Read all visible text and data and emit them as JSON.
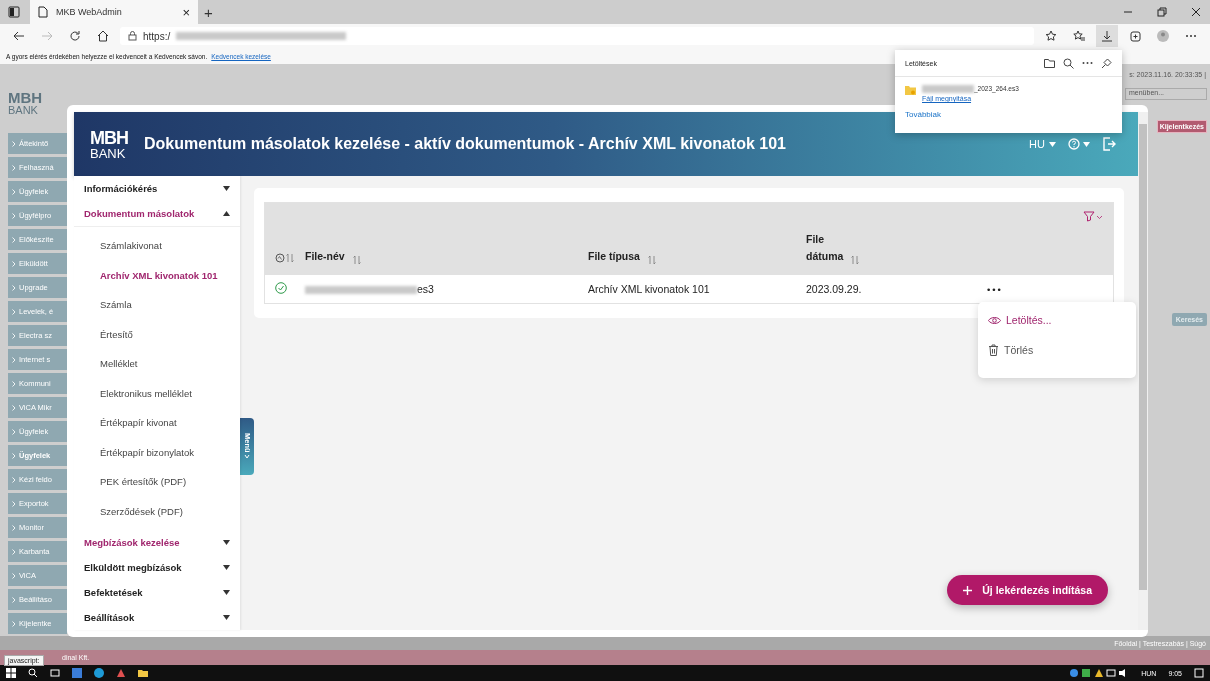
{
  "browser": {
    "tab": {
      "title": "MKB WebAdmin",
      "close": "×"
    },
    "new_tab": "+",
    "address": "https:/",
    "favorites_hint": "A gyors elérés érdekében helyezze el kedvenceit a Kedvencek sávon.",
    "favorites_link": "Kedvencek kezelése",
    "status_text": "javascript:"
  },
  "downloads": {
    "title": "Letöltések",
    "file": {
      "name": "_2023_264.es3",
      "action": "Fájl megnyitása"
    },
    "more": "Továbbiak"
  },
  "background": {
    "logo": {
      "mark": "MBH",
      "name": "BANK"
    },
    "session": "s: 2023.11.16. 20:33:35 |",
    "select": "menüben...",
    "logout": "Kijelentkezés",
    "search": "Keresés",
    "nav": [
      {
        "label": "Áttekintő",
        "selected": false
      },
      {
        "label": "Felhaszná",
        "selected": false
      },
      {
        "label": "Ügyfelek",
        "selected": false
      },
      {
        "label": "Ügyfélpro",
        "selected": false
      },
      {
        "label": "Előkészíte",
        "selected": false
      },
      {
        "label": "Elküldött",
        "selected": false
      },
      {
        "label": "Upgrade",
        "selected": false
      },
      {
        "label": "Levelek, é",
        "selected": false
      },
      {
        "label": "Electra sz",
        "selected": false
      },
      {
        "label": "Internet s",
        "selected": false
      },
      {
        "label": "Kommuni",
        "selected": false
      },
      {
        "label": "ViCA Mikr",
        "selected": false
      },
      {
        "label": "Ügyfelek",
        "selected": false
      },
      {
        "label": "Ügyfelek",
        "selected": true
      },
      {
        "label": "Kézi feldo",
        "selected": false
      },
      {
        "label": "Exportok",
        "selected": false
      },
      {
        "label": "Monitor",
        "selected": false
      },
      {
        "label": "Karbanta",
        "selected": false
      },
      {
        "label": "ViCA",
        "selected": false
      },
      {
        "label": "Beállításo",
        "selected": false
      },
      {
        "label": "Kijelentke",
        "selected": false
      }
    ],
    "footer": "Főoldal | Testreszabás | Súgó",
    "company": "dinal Kft."
  },
  "modal": {
    "logo": {
      "mark": "MBH",
      "name": "BANK"
    },
    "title": "Dokumentum másolatok kezelése - aktív dokumentumok - Archív XML kivonatok 101",
    "language": "HU"
  },
  "sidebar": {
    "toggle": "Menü",
    "groups": [
      {
        "label": "Információkérés",
        "active": false,
        "expanded": false
      },
      {
        "label": "Dokumentum másolatok",
        "active": true,
        "expanded": true,
        "children": [
          {
            "label": "Számlakivonat",
            "selected": false
          },
          {
            "label": "Archív XML kivonatok 101",
            "selected": true
          },
          {
            "label": "Számla",
            "selected": false
          },
          {
            "label": "Értesítő",
            "selected": false
          },
          {
            "label": "Melléklet",
            "selected": false
          },
          {
            "label": "Elektronikus melléklet",
            "selected": false
          },
          {
            "label": "Értékpapír kivonat",
            "selected": false
          },
          {
            "label": "Értékpapír bizonylatok",
            "selected": false
          },
          {
            "label": "PEK értesítők (PDF)",
            "selected": false
          },
          {
            "label": "Szerződések (PDF)",
            "selected": false
          }
        ]
      },
      {
        "label": "Megbízások kezelése",
        "active": true,
        "expanded": false
      },
      {
        "label": "Elküldött megbízások",
        "active": false,
        "expanded": false
      },
      {
        "label": "Befektetések",
        "active": false,
        "expanded": false
      },
      {
        "label": "Beállítások",
        "active": false,
        "expanded": false
      }
    ]
  },
  "table": {
    "columns": [
      "File-név",
      "File típusa",
      "File\ndátuma"
    ],
    "rows": [
      {
        "completed": true,
        "file_name": "es3",
        "file_type": "Archív XML kivonatok 101",
        "file_date": "2023.09.29.",
        "actions": "•••"
      }
    ]
  },
  "row_menu": {
    "items": [
      {
        "label": "Letöltés...",
        "kind": "view",
        "selected": true
      },
      {
        "label": "Törlés",
        "kind": "delete",
        "selected": false
      }
    ]
  },
  "new_query_button": {
    "label": "Új lekérdezés indítása"
  },
  "taskbar": {
    "language": "HUN",
    "time": "9:05"
  }
}
